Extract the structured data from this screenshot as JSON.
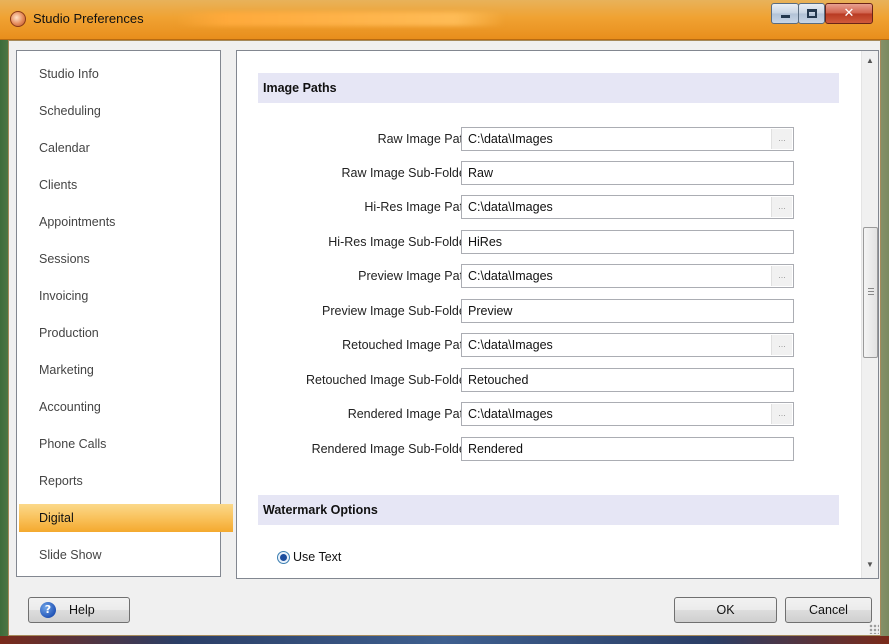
{
  "window": {
    "title": "Studio Preferences"
  },
  "sidebar": {
    "items": [
      {
        "label": "Studio Info"
      },
      {
        "label": "Scheduling"
      },
      {
        "label": "Calendar"
      },
      {
        "label": "Clients"
      },
      {
        "label": "Appointments"
      },
      {
        "label": "Sessions"
      },
      {
        "label": "Invoicing"
      },
      {
        "label": "Production"
      },
      {
        "label": "Marketing"
      },
      {
        "label": "Accounting"
      },
      {
        "label": "Phone Calls"
      },
      {
        "label": "Reports"
      },
      {
        "label": "Digital",
        "selected": true
      },
      {
        "label": "Slide Show"
      }
    ]
  },
  "image_paths": {
    "header": "Image Paths",
    "fields": [
      {
        "label": "Raw Image Path",
        "value": "C:\\data\\Images",
        "browse": "..."
      },
      {
        "label": "Raw Image Sub-Folder",
        "value": "Raw"
      },
      {
        "label": "Hi-Res Image Path",
        "value": "C:\\data\\Images",
        "browse": "..."
      },
      {
        "label": "Hi-Res Image Sub-Folder",
        "value": "HiRes"
      },
      {
        "label": "Preview Image Path",
        "value": "C:\\data\\Images",
        "browse": "..."
      },
      {
        "label": "Preview Image Sub-Folder",
        "value": "Preview"
      },
      {
        "label": "Retouched Image Path",
        "value": "C:\\data\\Images",
        "browse": "..."
      },
      {
        "label": "Retouched Image Sub-Folder",
        "value": "Retouched"
      },
      {
        "label": "Rendered Image Path",
        "value": "C:\\data\\Images",
        "browse": "..."
      },
      {
        "label": "Rendered Image Sub-Folder",
        "value": "Rendered"
      }
    ]
  },
  "watermark": {
    "header": "Watermark Options",
    "use_text_label": "Use Text",
    "use_text_selected": true
  },
  "buttons": {
    "help": "Help",
    "ok": "OK",
    "cancel": "Cancel"
  },
  "colors": {
    "titlebar_accent": "#f0a232",
    "selected_item": "#f9c25c",
    "section_header_bg": "#e6e6f5"
  },
  "icons": {
    "app": "studio-logo-icon",
    "help": "help-question-icon",
    "radio": "radio-selected-icon"
  }
}
